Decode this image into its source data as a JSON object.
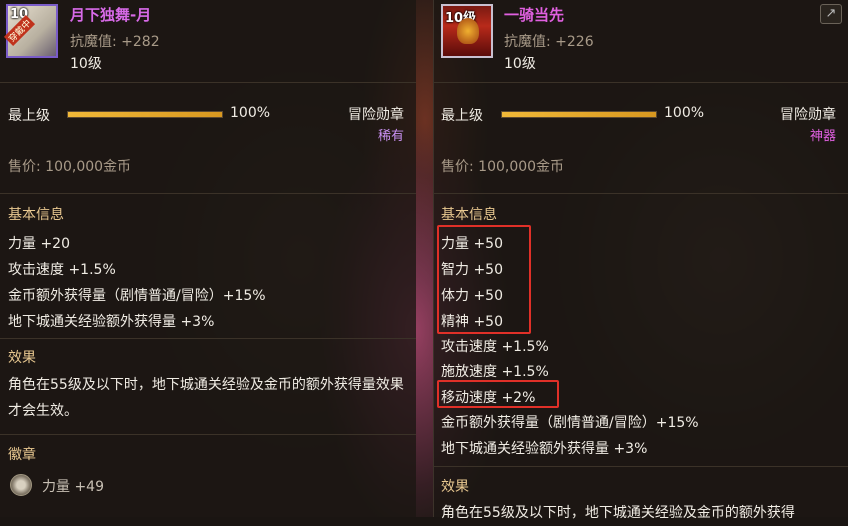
{
  "colors": {
    "legendary": "#d86ae8",
    "rare": "#c890f0",
    "artifact": "#e060e0",
    "gold": "#e8c890"
  },
  "left": {
    "icon": {
      "wear_tag": "穿戴中",
      "level_tag": "10"
    },
    "name": "月下独舞-月",
    "anti_magic": "抗魔值: +282",
    "level": "10级",
    "max_level_label": "最上级",
    "progress": 1.0,
    "progress_text": "100%",
    "item_type": "冒险勋章",
    "rarity": "稀有",
    "price": "售价: 100,000金币",
    "basic_info_title": "基本信息",
    "stats": [
      "力量 +20",
      "攻击速度 +1.5%",
      "金币额外获得量（剧情普通/冒险）+15%",
      "地下城通关经验额外获得量 +3%"
    ],
    "effect_title": "效果",
    "effect_text": "角色在55级及以下时，地下城通关经验及金币的额外获得量效果才会生效。",
    "emblem_title": "徽章",
    "emblem_stat": "力量 +49"
  },
  "right": {
    "icon": {
      "level_tag": "10级"
    },
    "name": "一骑当先",
    "anti_magic": "抗魔值: +226",
    "level": "10级",
    "max_level_label": "最上级",
    "progress": 1.0,
    "progress_text": "100%",
    "item_type": "冒险勋章",
    "rarity": "神器",
    "price": "售价: 100,000金币",
    "basic_info_title": "基本信息",
    "stats": [
      "力量 +50",
      "智力 +50",
      "体力 +50",
      "精神 +50",
      "攻击速度 +1.5%",
      "施放速度 +1.5%",
      "移动速度 +2%",
      "金币额外获得量（剧情普通/冒险）+15%",
      "地下城通关经验额外获得量 +3%"
    ],
    "effect_title": "效果",
    "effect_text_partial": "角色在55级及以下时，地下城通关经验及金币的额外获得"
  }
}
